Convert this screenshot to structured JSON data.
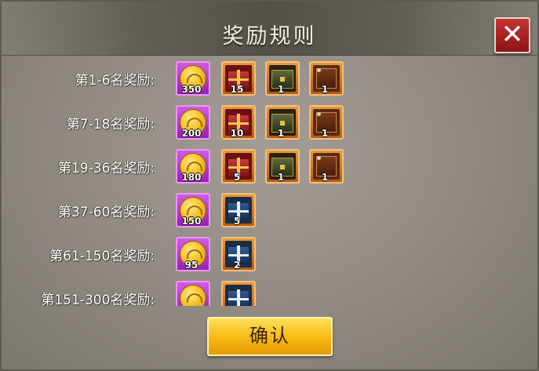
{
  "dialog": {
    "title": "奖励规则",
    "close_label": "✕",
    "confirm_label": "确认"
  },
  "rows": [
    {
      "label": "第1-6名奖励:",
      "items": [
        {
          "type": "gold-coin",
          "rarity": "purple",
          "count": "350"
        },
        {
          "type": "red-gift-box",
          "rarity": "orange",
          "count": "15"
        },
        {
          "type": "green-chest",
          "rarity": "orange",
          "count": "1"
        },
        {
          "type": "brown-frame",
          "rarity": "orange",
          "count": "1"
        }
      ]
    },
    {
      "label": "第7-18名奖励:",
      "items": [
        {
          "type": "gold-coin",
          "rarity": "purple",
          "count": "200"
        },
        {
          "type": "red-gift-box",
          "rarity": "orange",
          "count": "10"
        },
        {
          "type": "green-chest",
          "rarity": "orange",
          "count": "1"
        },
        {
          "type": "brown-frame",
          "rarity": "orange",
          "count": "1"
        }
      ]
    },
    {
      "label": "第19-36名奖励:",
      "items": [
        {
          "type": "gold-coin",
          "rarity": "purple",
          "count": "180"
        },
        {
          "type": "red-gift-box",
          "rarity": "orange",
          "count": "5"
        },
        {
          "type": "green-chest",
          "rarity": "orange",
          "count": "1"
        },
        {
          "type": "brown-frame",
          "rarity": "orange",
          "count": "1"
        }
      ]
    },
    {
      "label": "第37-60名奖励:",
      "items": [
        {
          "type": "gold-coin",
          "rarity": "purple",
          "count": "150"
        },
        {
          "type": "blue-gift-box",
          "rarity": "orange",
          "count": "5"
        }
      ]
    },
    {
      "label": "第61-150名奖励:",
      "items": [
        {
          "type": "gold-coin",
          "rarity": "purple",
          "count": "95"
        },
        {
          "type": "blue-gift-box",
          "rarity": "orange",
          "count": "2"
        }
      ]
    },
    {
      "label": "第151-300名奖励:",
      "items": [
        {
          "type": "gold-coin",
          "rarity": "purple",
          "count": ""
        },
        {
          "type": "blue-gift-box",
          "rarity": "orange",
          "count": ""
        }
      ]
    }
  ],
  "colors": {
    "purple_frame": "#b53ad0",
    "orange_frame": "#d17a25",
    "confirm_button": "#f7b812",
    "close_button": "#b52525"
  }
}
